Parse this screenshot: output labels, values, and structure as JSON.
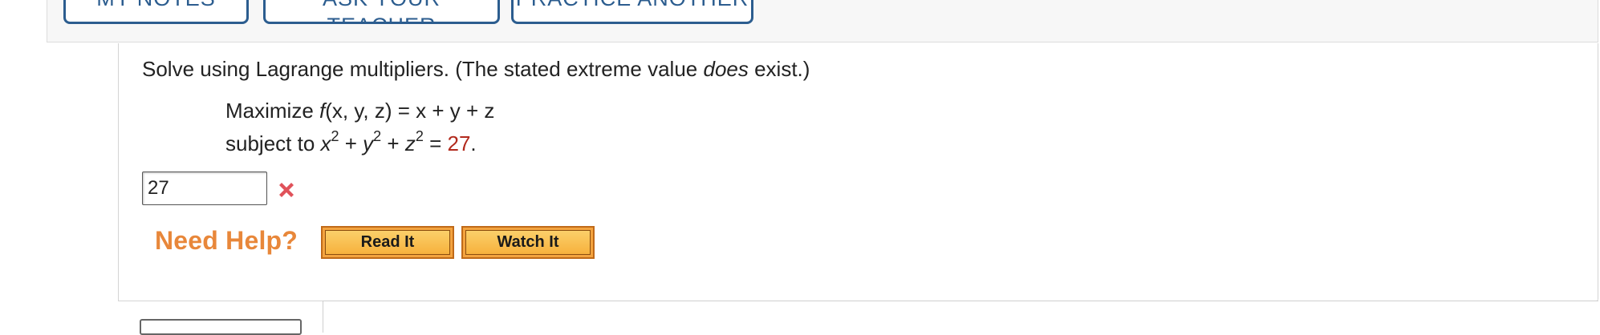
{
  "top_buttons": [
    {
      "label": "MY NOTES"
    },
    {
      "label": "ASK YOUR TEACHER"
    },
    {
      "label": "PRACTICE ANOTHER"
    }
  ],
  "question": {
    "instruction_prefix": "Solve using Lagrange multipliers. (The stated extreme value ",
    "instruction_emphasis": "does",
    "instruction_suffix": " exist.)",
    "objective_prefix": "Maximize ",
    "objective_func": "f",
    "objective_args": "(x, y, z) = x + y + z",
    "constraint_prefix": "subject to ",
    "constraint_value": "27"
  },
  "answer": {
    "value": "27",
    "status": "incorrect",
    "status_icon": "x-mark-icon"
  },
  "help": {
    "label": "Need Help?",
    "read_label": "Read It",
    "watch_label": "Watch It"
  },
  "colors": {
    "accent_blue": "#2c5d8f",
    "help_orange": "#e8873a",
    "wrong_red": "#e0525a",
    "value_red": "#b22a1d"
  }
}
